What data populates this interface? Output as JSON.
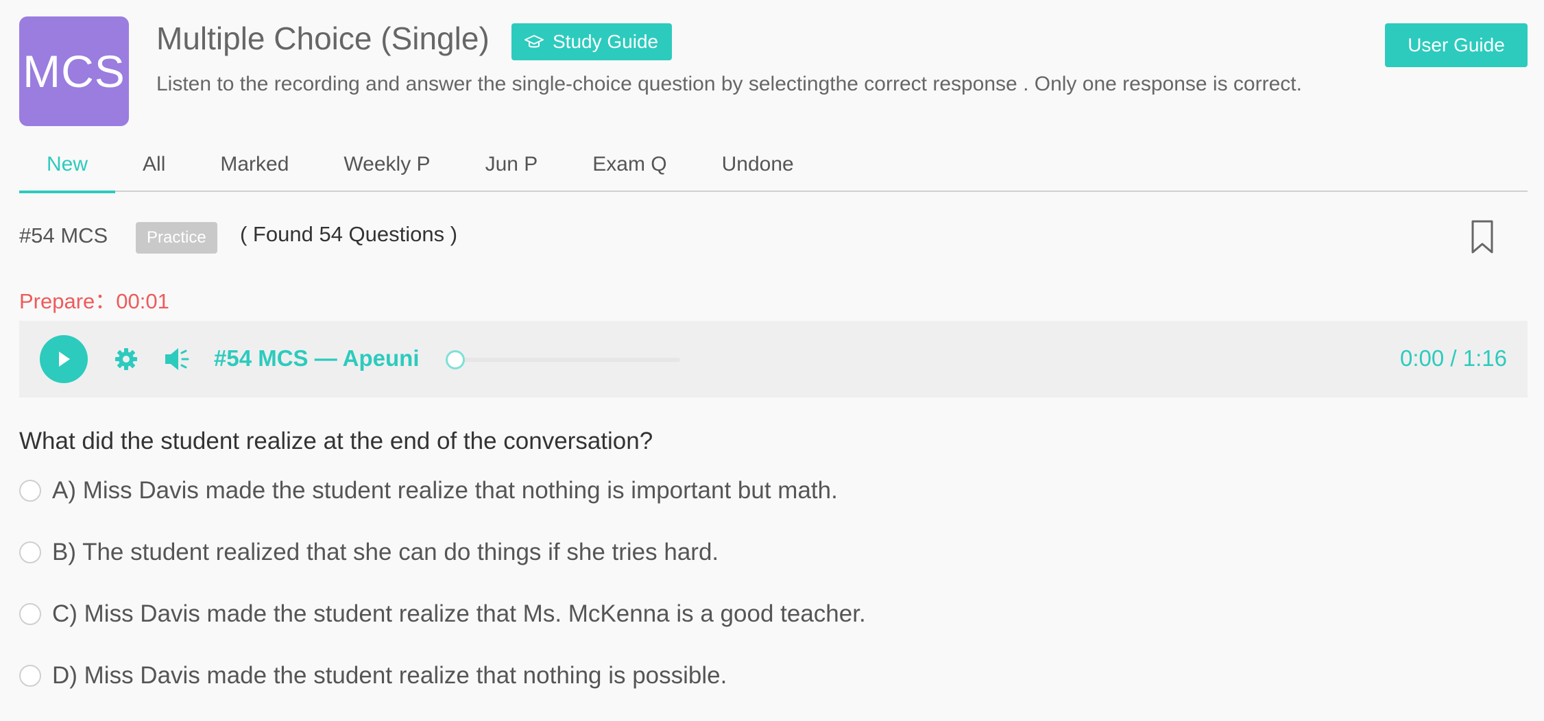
{
  "header": {
    "logo_text": "MCS",
    "title": "Multiple Choice (Single)",
    "study_guide_label": "Study Guide",
    "user_guide_label": "User Guide",
    "subtitle": "Listen to the recording and answer the single-choice question by selectingthe correct response . Only one response is correct."
  },
  "tabs": [
    {
      "label": "New",
      "active": true
    },
    {
      "label": "All"
    },
    {
      "label": "Marked"
    },
    {
      "label": "Weekly P"
    },
    {
      "label": "Jun P"
    },
    {
      "label": "Exam Q"
    },
    {
      "label": "Undone"
    }
  ],
  "info": {
    "question_id": "#54 MCS",
    "badge": "Practice",
    "found_text": "( Found 54 Questions )"
  },
  "prepare": "Prepare：00:01",
  "player": {
    "title": "#54 MCS — Apeuni",
    "time": "0:00 / 1:16",
    "progress": 0
  },
  "question": "What did the student realize at the end of the conversation?",
  "options": [
    "A) Miss Davis made the student realize that nothing is important but math.",
    "B) The student realized that she can do things if she tries hard.",
    "C) Miss Davis made the student realize that Ms. McKenna is a good teacher.",
    "D) Miss Davis made the student realize that nothing is possible."
  ],
  "colors": {
    "accent": "#2ccbbd",
    "logo": "#9a7ddf",
    "prepare": "#ef5a5a"
  },
  "icons": [
    "graduation-cap-icon",
    "bookmark-icon",
    "play-icon",
    "gear-icon",
    "speaker-icon"
  ]
}
